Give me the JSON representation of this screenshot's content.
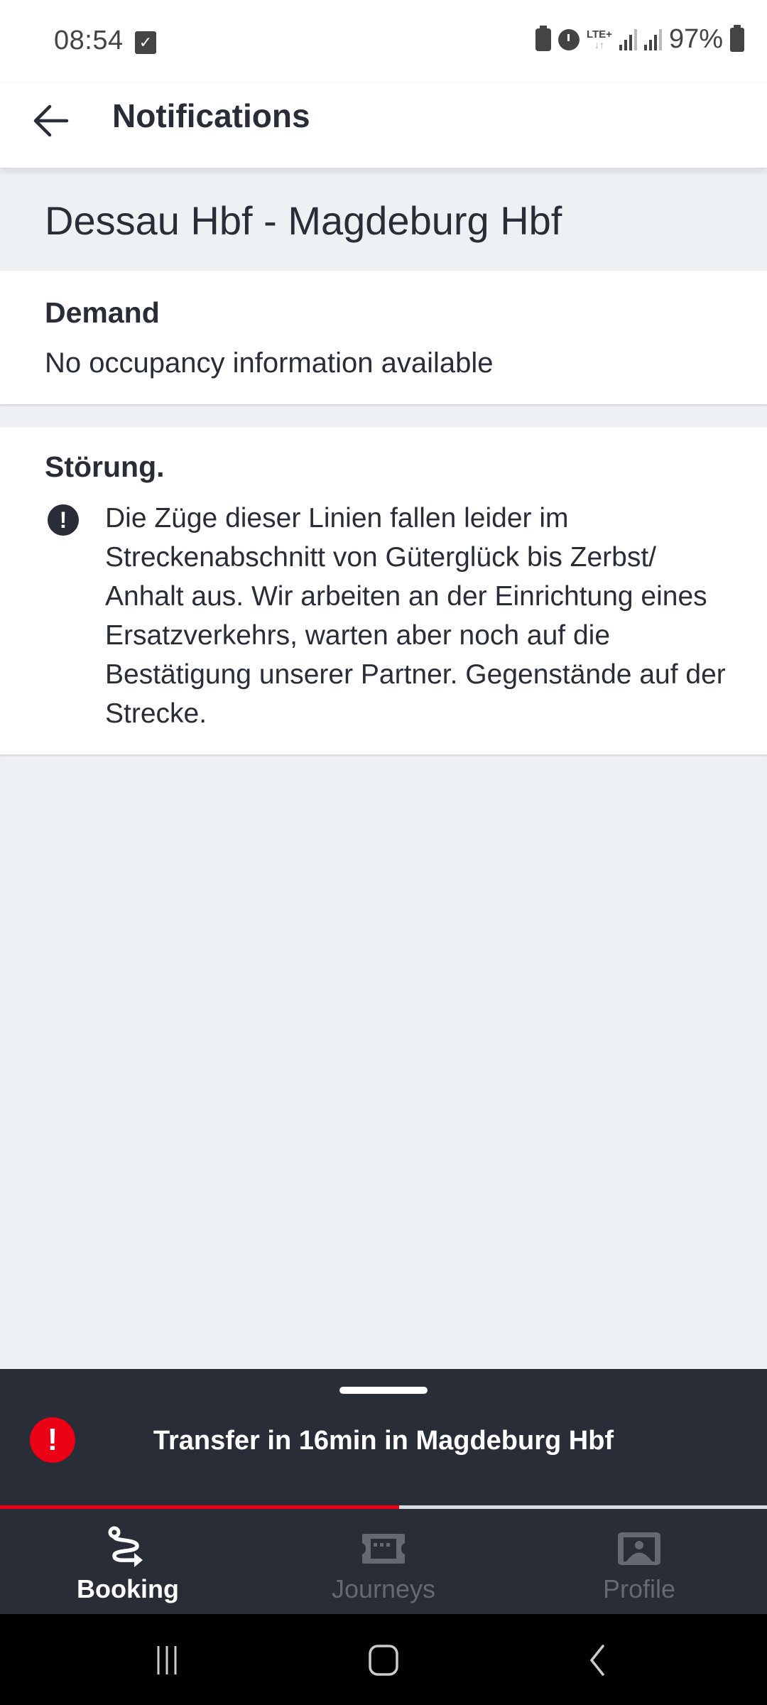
{
  "status_bar": {
    "time": "08:54",
    "battery_percent": "97%",
    "network": "LTE+",
    "icons": [
      "task-check-icon",
      "battery-saver-icon",
      "alarm-icon",
      "lte-icon",
      "signal-icon",
      "signal-icon",
      "battery-icon"
    ]
  },
  "app_bar": {
    "back_icon": "arrow-left-icon",
    "title": "Notifications"
  },
  "route": {
    "title": "Dessau Hbf - Magdeburg Hbf"
  },
  "demand": {
    "title": "Demand",
    "text": "No occupancy information available"
  },
  "disruption": {
    "title": "Störung.",
    "icon": "exclamation-circle-icon",
    "text": "Die Züge dieser Linien fallen leider im Streckenabschnitt von Güterglück bis Zerbst/ Anhalt aus. Wir arbeiten an der Einrichtung eines Ersatzverkehrs, warten aber noch auf die Bestätigung unserer Partner. Gegenstände auf der Strecke."
  },
  "bottom_sheet": {
    "icon": "warning-icon",
    "text": "Transfer in 16min in Magdeburg Hbf",
    "progress_percent": 52,
    "accent_color": "#ec0016"
  },
  "nav": {
    "items": [
      {
        "label": "Booking",
        "icon": "route-icon",
        "active": true
      },
      {
        "label": "Journeys",
        "icon": "ticket-icon",
        "active": false
      },
      {
        "label": "Profile",
        "icon": "profile-icon",
        "active": false
      }
    ]
  },
  "system_nav": {
    "buttons": [
      "recent-apps-icon",
      "home-icon",
      "back-icon"
    ]
  }
}
